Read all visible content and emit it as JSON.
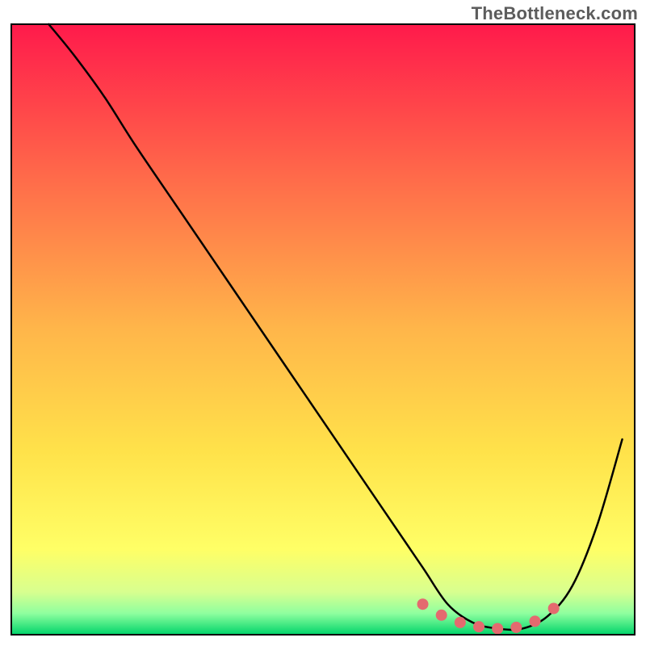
{
  "watermark": "TheBottleneck.com",
  "chart_data": {
    "type": "line",
    "title": "",
    "xlabel": "",
    "ylabel": "",
    "xlim": [
      0,
      100
    ],
    "ylim": [
      0,
      100
    ],
    "grid": false,
    "legend": false,
    "background_gradient_stops": [
      {
        "offset": 0.0,
        "color": "#ff1a4b"
      },
      {
        "offset": 0.25,
        "color": "#ff6a4a"
      },
      {
        "offset": 0.5,
        "color": "#ffb64a"
      },
      {
        "offset": 0.7,
        "color": "#ffe24a"
      },
      {
        "offset": 0.86,
        "color": "#ffff66"
      },
      {
        "offset": 0.93,
        "color": "#d8ff8f"
      },
      {
        "offset": 0.965,
        "color": "#8fff9f"
      },
      {
        "offset": 1.0,
        "color": "#00d46a"
      }
    ],
    "series": [
      {
        "name": "bottleneck-curve",
        "color": "#000000",
        "x": [
          6,
          10,
          15,
          20,
          28,
          36,
          44,
          52,
          60,
          66,
          70,
          74,
          78,
          82,
          86,
          90,
          94,
          98
        ],
        "y": [
          100,
          95,
          88,
          80,
          68,
          56,
          44,
          32,
          20,
          11,
          5,
          2,
          1,
          1,
          3,
          8,
          18,
          32
        ]
      }
    ],
    "markers": {
      "name": "bottleneck-zone",
      "color": "#e46a6f",
      "radius_px": 7,
      "x": [
        66,
        69,
        72,
        75,
        78,
        81,
        84,
        87
      ],
      "y": [
        5.0,
        3.2,
        2.0,
        1.3,
        1.0,
        1.2,
        2.2,
        4.3
      ]
    }
  }
}
